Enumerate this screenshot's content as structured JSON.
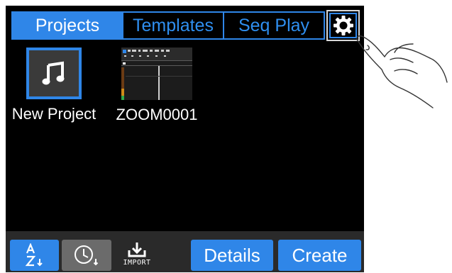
{
  "tabs": {
    "projects": "Projects",
    "templates": "Templates",
    "seq_play": "Seq Play"
  },
  "settings": {
    "icon": "gear-icon"
  },
  "projects": [
    {
      "name": "New Project",
      "icon": "music-note-icon"
    },
    {
      "name": "ZOOM0001",
      "icon": "project-thumbnail"
    }
  ],
  "toolbar": {
    "sort_az_icon": "sort-alphabetical-icon",
    "sort_time_icon": "sort-by-time-icon",
    "import_label": "IMPORT",
    "details_label": "Details",
    "create_label": "Create"
  },
  "colors": {
    "accent": "#2f86e8",
    "screen_bg": "#000000",
    "toolbar_bg": "#2a2a2a",
    "button_gray": "#6b6b6b"
  }
}
